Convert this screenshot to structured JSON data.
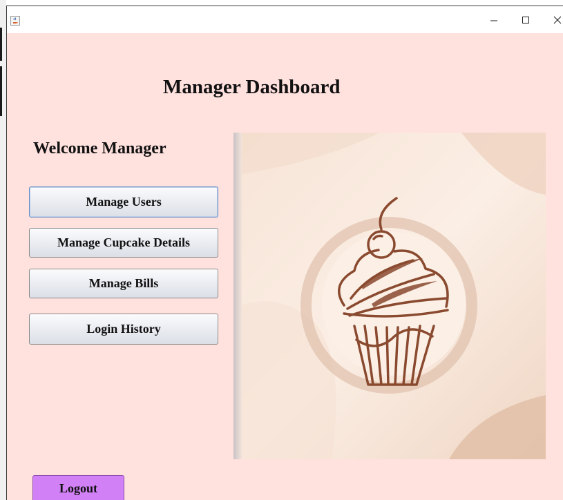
{
  "window": {
    "icon": "java-cup-icon",
    "controls": {
      "minimize": "–",
      "maximize": "☐",
      "close": "✕"
    }
  },
  "header": {
    "title": "Manager Dashboard"
  },
  "sidebar": {
    "welcome": "Welcome Manager",
    "buttons": [
      {
        "label": "Manage Users"
      },
      {
        "label": "Manage Cupcake Details"
      },
      {
        "label": "Manage Bills"
      },
      {
        "label": "Login History"
      }
    ]
  },
  "image": {
    "icon": "cupcake-illustration"
  },
  "footer": {
    "logout_label": "Logout"
  },
  "colors": {
    "background": "#ffe1de",
    "logout": "#d180f5",
    "illustration_stroke": "#8a4a2f"
  }
}
